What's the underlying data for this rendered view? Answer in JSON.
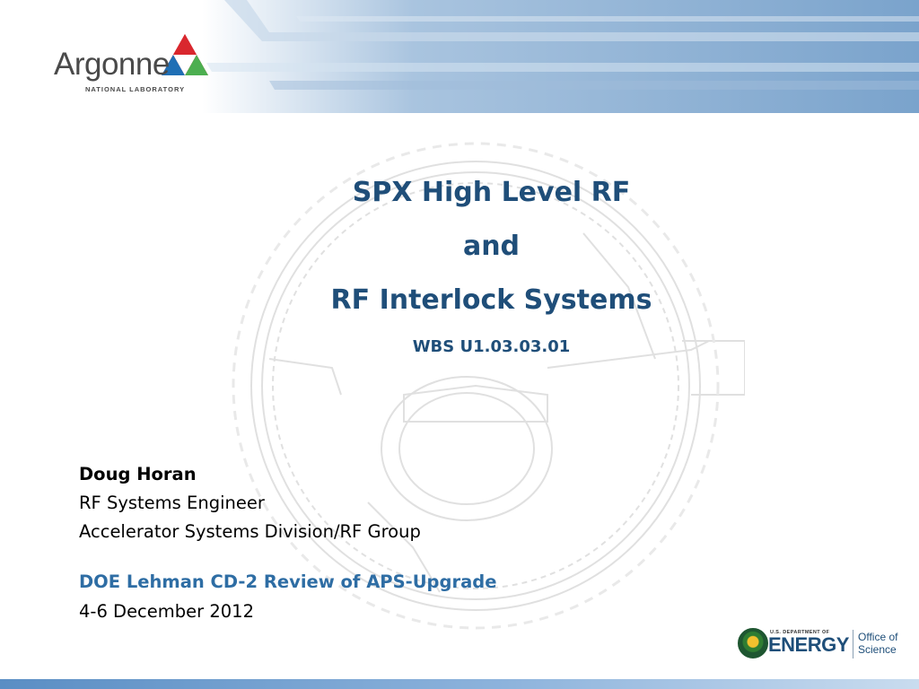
{
  "header": {
    "org_name": "Argonne",
    "org_subtitle": "NATIONAL LABORATORY"
  },
  "title": {
    "line1": "SPX High Level RF",
    "line2": "and",
    "line3": "RF Interlock Systems",
    "wbs": "WBS U1.03.03.01"
  },
  "author": {
    "name": "Doug Horan",
    "role": "RF Systems Engineer",
    "division": "Accelerator Systems Division/RF Group"
  },
  "event": {
    "review": "DOE Lehman CD-2 Review of APS-Upgrade",
    "date": "4-6 December 2012"
  },
  "sponsor": {
    "dept_line": "U.S. DEPARTMENT OF",
    "energy": "ENERGY",
    "office_line1": "Office of",
    "office_line2": "Science"
  },
  "colors": {
    "title_blue": "#1f4e79",
    "review_blue": "#2e6da4",
    "header_blue": "#7ea6cd",
    "logo_red": "#d9272e",
    "logo_green": "#4caf50",
    "logo_blue": "#1f6fb5"
  }
}
